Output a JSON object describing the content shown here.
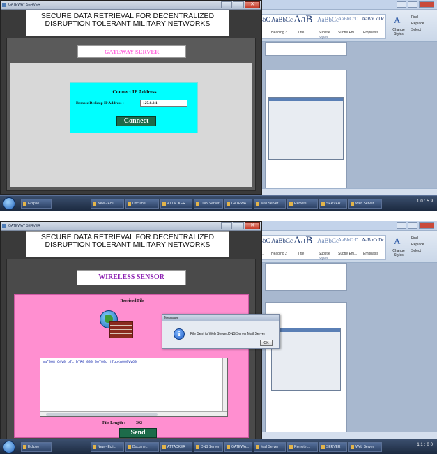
{
  "screen1": {
    "app": {
      "window_title": "GATEWAY SERVER",
      "heading": "SECURE DATA RETRIEVAL FOR DECENTRALIZED DISRUPTION TOLERANT MILITARY NETWORKS",
      "banner": "GATEWAY SERVER",
      "connect_panel": {
        "title": "Connect IP Address",
        "ip_label": "Remote Desktop IP Address :",
        "ip_value": "127.0.0.1",
        "button": "Connect"
      }
    },
    "word": {
      "styles": [
        {
          "sample": "BbC",
          "name": "g 1"
        },
        {
          "sample": "AaBbCc",
          "name": "Heading 2"
        },
        {
          "sample": "AaB",
          "name": "Title"
        },
        {
          "sample": "AaBbCc",
          "name": "Subtitle"
        },
        {
          "sample": "AaBbCcD",
          "name": "Subtle Em..."
        },
        {
          "sample": "AaBbCcDc",
          "name": "Emphasis"
        }
      ],
      "change_styles": "Change Styles",
      "editing": [
        "Find",
        "Replace",
        "Select"
      ],
      "group_label": "Styles"
    },
    "taskbar": {
      "items": [
        "Eclipse",
        "New - Ecli...",
        "Docume...",
        "ATTACKER",
        "DNS Server",
        "GATEWA...",
        "Mail Server",
        "Remote ...",
        "SERVER",
        "Web Server"
      ],
      "clock": "10:59"
    }
  },
  "screen2": {
    "app": {
      "window_title": "GATEWAY SERVER",
      "heading": "SECURE DATA RETRIEVAL FOR DECENTRALIZED DISRUPTION TOLERANT MILITARY NETWORKS",
      "banner": "WIRELESS SENSOR",
      "received_label": "Received File",
      "file_text": "ma*0O8`O#V0 oTc'bTR0 000 0oT00u_jTqp<n000VV60",
      "file_length_label": "File Length :",
      "file_length_value": "302",
      "send_button": "Send"
    },
    "dialog": {
      "title": "Message",
      "icon": "info-icon",
      "message": "File Sent to Web Server,DNS Server,Mail Server",
      "ok": "OK"
    },
    "word": {
      "styles": [
        {
          "sample": "BbC",
          "name": "g 1"
        },
        {
          "sample": "AaBbCc",
          "name": "Heading 2"
        },
        {
          "sample": "AaB",
          "name": "Title"
        },
        {
          "sample": "AaBbCc",
          "name": "Subtitle"
        },
        {
          "sample": "AaBbCcD",
          "name": "Subtle Em..."
        },
        {
          "sample": "AaBbCcDc",
          "name": "Emphasis"
        }
      ],
      "change_styles": "Change Styles",
      "editing": [
        "Find",
        "Replace",
        "Select"
      ],
      "group_label": "Styles"
    },
    "taskbar": {
      "items": [
        "Eclipse",
        "New - Ecli...",
        "Docume...",
        "ATTACKER",
        "DNS Server",
        "GATEWA...",
        "Mail Server",
        "Remote ...",
        "SERVER",
        "Web Server"
      ],
      "clock": "11:00"
    }
  },
  "colors": {
    "cyan_panel": "#00ffff",
    "pink_panel": "#ff8fd0",
    "banner_text_pink": "#ff66dd",
    "banner_text_purple": "#8b1fb0",
    "button_green": "#1d6b4a"
  }
}
